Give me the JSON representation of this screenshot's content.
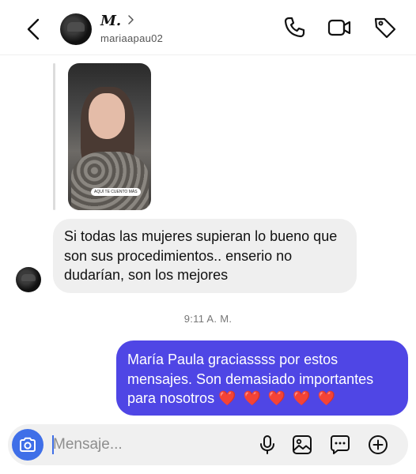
{
  "header": {
    "display_name": "M.",
    "username": "mariaapau02",
    "icons": [
      "back-arrow-icon",
      "phone-icon",
      "video-icon",
      "tag-icon"
    ]
  },
  "shared_media": {
    "caption": "AQUÍ TE CUENTO MÁS"
  },
  "messages": [
    {
      "direction": "incoming",
      "text": "Si todas las mujeres supieran lo bueno que son sus procedimientos.. enserio no dudarían, son los mejores"
    },
    {
      "direction": "outgoing",
      "text": "María Paula graciassss por estos mensajes. Son demasiado importantes para nosotros",
      "emoji": "❤️ ❤️ ❤️ ❤️ ❤️"
    }
  ],
  "timestamp": "9:11 A. M.",
  "composer": {
    "placeholder": "Mensaje...",
    "value": "",
    "icons": [
      "camera-icon",
      "microphone-icon",
      "gallery-icon",
      "sticker-icon",
      "add-icon"
    ]
  },
  "colors": {
    "outgoing_bubble": "#4f46e5",
    "incoming_bubble": "#efefef",
    "camera_button": "#3f6fe8"
  }
}
